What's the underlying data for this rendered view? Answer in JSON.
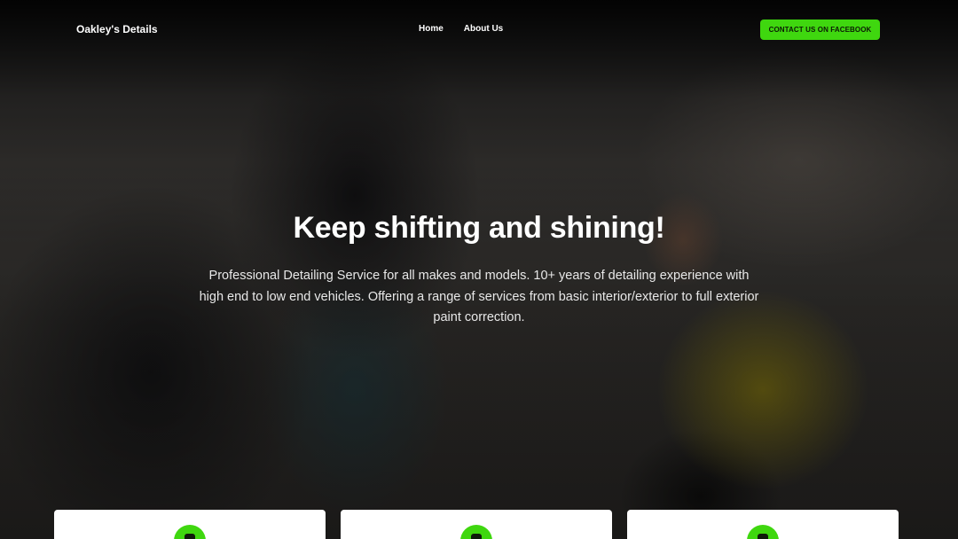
{
  "header": {
    "brand": "Oakley's Details",
    "nav": [
      {
        "label": "Home"
      },
      {
        "label": "About Us"
      }
    ],
    "cta_label": "CONTACT US ON FACEBOOK"
  },
  "hero": {
    "title": "Keep shifting and shining!",
    "description": "Professional Detailing Service for all makes and models. 10+ years of detailing experience with high end to low end vehicles. Offering a range of services from basic interior/exterior to full exterior paint correction."
  },
  "feature_cards": [
    {
      "icon": "service-icon"
    },
    {
      "icon": "service-icon"
    },
    {
      "icon": "service-icon"
    }
  ],
  "colors": {
    "accent": "#3fd70f",
    "card_background": "#ffffff",
    "text_primary": "#ffffff"
  }
}
